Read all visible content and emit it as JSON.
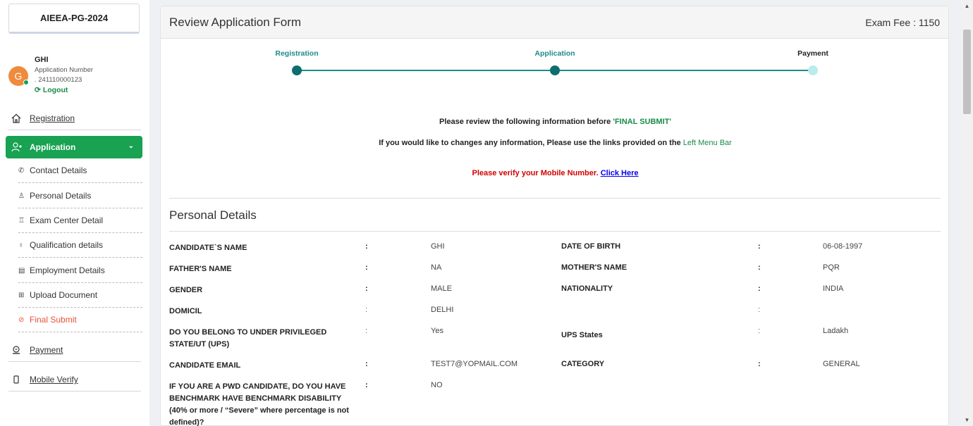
{
  "sidebar": {
    "exam_code": "AIEEA-PG-2024",
    "user": {
      "avatar_letter": "G",
      "name": "GHI",
      "application_label": "Application Number",
      "application_number": ". 241110000123",
      "logout_label": "Logout"
    },
    "nav": {
      "registration": "Registration",
      "application": "Application",
      "payment": "Payment",
      "mobile_verify": "Mobile Verify"
    },
    "sub_items": [
      {
        "label": "Contact Details",
        "icon": "phone-icon"
      },
      {
        "label": "Personal Details",
        "icon": "person-icon"
      },
      {
        "label": "Exam Center Detail",
        "icon": "exam-center-icon"
      },
      {
        "label": "Qualification details",
        "icon": "qualification-icon"
      },
      {
        "label": "Employment Details",
        "icon": "employment-icon"
      },
      {
        "label": "Upload Document",
        "icon": "upload-icon"
      },
      {
        "label": "Final Submit",
        "icon": "check-circle-icon"
      }
    ]
  },
  "main": {
    "title": "Review Application Form",
    "exam_fee": "Exam Fee : 1150",
    "steps": [
      {
        "label": "Registration",
        "status": "done"
      },
      {
        "label": "Application",
        "status": "done"
      },
      {
        "label": "Payment",
        "status": "pending"
      }
    ],
    "notice_line1_prefix": "Please review the following information before ",
    "notice_line1_highlight": "'FINAL SUBMIT'",
    "notice_line2_prefix": "If you would like to changes any information, Please use the links provided on the ",
    "notice_line2_highlight": "Left Menu Bar",
    "verify_text": "Please verify your Mobile Number. ",
    "verify_link": "Click Here",
    "section_title": "Personal Details",
    "separator": ":",
    "rows": [
      {
        "l1": "CANDIDATE`S NAME",
        "v1": "GHI",
        "l2": "DATE OF BIRTH",
        "v2": "06-08-1997"
      },
      {
        "l1": "FATHER'S NAME",
        "v1": "NA",
        "l2": "MOTHER'S NAME",
        "v2": "PQR"
      },
      {
        "l1": "GENDER",
        "v1": "MALE",
        "l2": "NATIONALITY",
        "v2": "INDIA"
      },
      {
        "l1": "DOMICIL",
        "v1": "DELHI",
        "l2": "",
        "v2": ""
      },
      {
        "l1": "DO YOU BELONG TO UNDER PRIVILEGED STATE/UT (UPS)",
        "v1": "Yes",
        "l2": "UPS States",
        "v2": "Ladakh"
      },
      {
        "l1": "CANDIDATE EMAIL",
        "v1": "TEST7@YOPMAIL.COM",
        "l2": "CATEGORY",
        "v2": "GENERAL"
      },
      {
        "l1": "IF YOU ARE A PWD CANDIDATE, DO YOU HAVE BENCHMARK HAVE BENCHMARK DISABILITY (40% or more / “Severe” where percentage is not defined)?",
        "v1": "NO",
        "l2": "",
        "v2": ""
      }
    ]
  },
  "colors": {
    "accent_green": "#18a252",
    "stepper_teal": "#1d8a8a",
    "final_submit": "#e8503a",
    "verify_red": "#d10000"
  }
}
